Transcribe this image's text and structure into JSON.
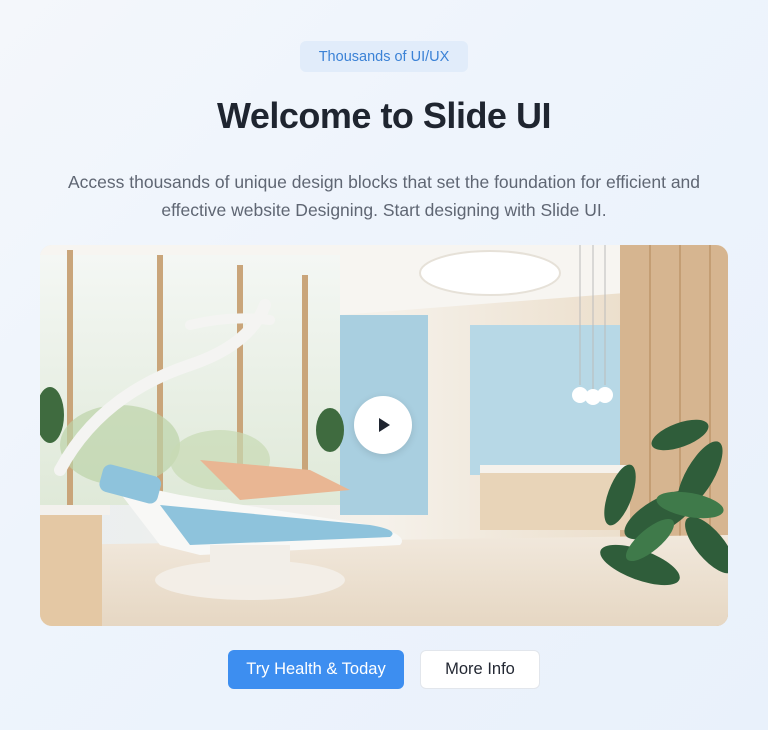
{
  "badge": {
    "label": "Thousands of UI/UX"
  },
  "hero": {
    "title": "Welcome to Slide UI",
    "description": "Access thousands of unique design blocks that set the foundation for efficient and effective website Designing. Start designing with Slide UI."
  },
  "video": {
    "play_icon": "play-icon"
  },
  "actions": {
    "primary_label": "Try Health & Today",
    "secondary_label": "More Info"
  },
  "colors": {
    "accent": "#3d8ef0",
    "badge_bg": "#e1ecfa",
    "badge_text": "#3b82d6",
    "title": "#1f2530",
    "body_text": "#5f6673"
  }
}
